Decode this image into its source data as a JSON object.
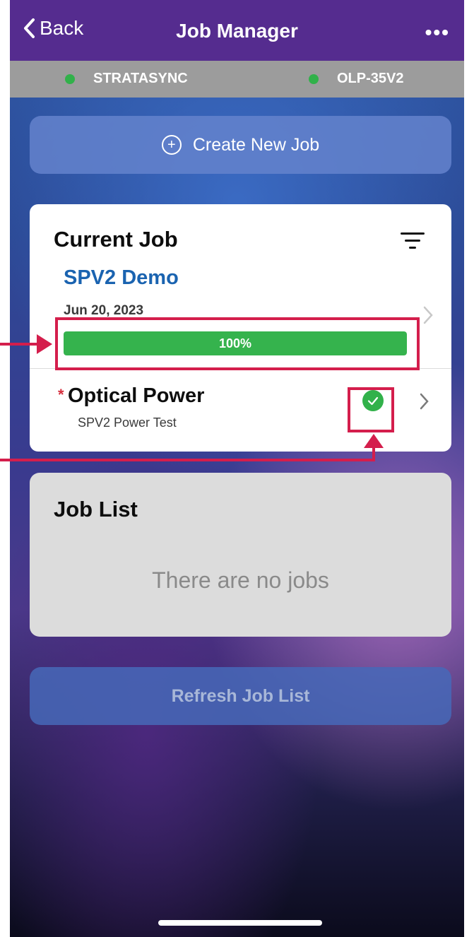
{
  "navbar": {
    "back_label": "Back",
    "title": "Job Manager",
    "more_label": "•••"
  },
  "status": {
    "items": [
      {
        "label": "STRATASYNC",
        "dot_color": "#31b14a"
      },
      {
        "label": "OLP-35V2",
        "dot_color": "#31b14a"
      }
    ]
  },
  "create_job": {
    "label": "Create New Job",
    "icon": "plus-circle-icon"
  },
  "current_job": {
    "heading": "Current Job",
    "job_name": "SPV2 Demo",
    "date": "Jun 20, 2023",
    "progress_text": "100%",
    "progress_fraction": 1.0,
    "tests": [
      {
        "required_marker": "*",
        "name": "Optical Power",
        "subtitle": "SPV2 Power Test",
        "status": "complete"
      }
    ]
  },
  "job_list": {
    "heading": "Job List",
    "empty_message": "There are no jobs"
  },
  "refresh": {
    "label": "Refresh Job List"
  },
  "colors": {
    "nav_purple": "#552c8f",
    "status_green": "#31b14a",
    "progress_green": "#35b34d",
    "job_blue": "#1a63b0",
    "annotation_red": "#d41e4c"
  }
}
